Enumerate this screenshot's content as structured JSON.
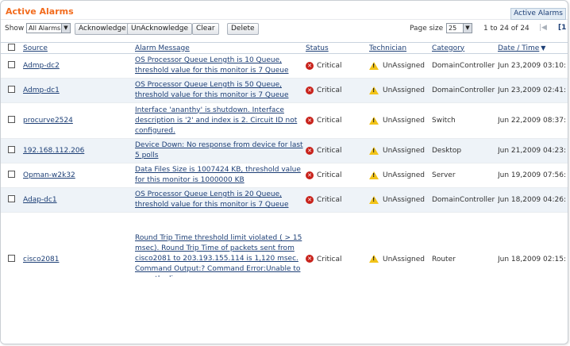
{
  "panel": {
    "title": "Active Alarms",
    "breadcrumb_tab": "Active Alarms"
  },
  "toolbar": {
    "show_label": "Show",
    "filter_select": "All Alarms",
    "acknowledge_label": "Acknowledge",
    "unacknowledge_label": "UnAcknowledge",
    "clear_label": "Clear",
    "delete_label": "Delete",
    "page_size_label": "Page size",
    "page_size_value": "25",
    "range_label": "1 to 24 of 24",
    "page_number_fragment": "[1"
  },
  "table": {
    "columns": {
      "source": "Source",
      "message": "Alarm Message",
      "status": "Status",
      "technician": "Technician",
      "category": "Category",
      "datetime": "Date / Time"
    },
    "rows": [
      {
        "source": "Admp-dc2",
        "message": "OS Processor Queue Length is 10 Queue, threshold value for this monitor is 7 Queue",
        "status": "Critical",
        "technician": "UnAssigned",
        "category": "DomainController",
        "datetime": "Jun 23,2009 03:10:"
      },
      {
        "source": "Admp-dc1",
        "message": "OS Processor Queue Length is 50 Queue, threshold value for this monitor is 7 Queue",
        "status": "Critical",
        "technician": "UnAssigned",
        "category": "DomainController",
        "datetime": "Jun 23,2009 02:41:"
      },
      {
        "source": "procurve2524",
        "message": "Interface 'ananthy' is shutdown. Interface description is '2' and index is 2. Circuit ID not configured.",
        "status": "Critical",
        "technician": "UnAssigned",
        "category": "Switch",
        "datetime": "Jun 22,2009 08:37:"
      },
      {
        "source": "192.168.112.206",
        "message": "Device Down: No response from device for last 5 polls",
        "status": "Critical",
        "technician": "UnAssigned",
        "category": "Desktop",
        "datetime": "Jun 21,2009 04:23:"
      },
      {
        "source": "Opman-w2k32",
        "message": "Data Files Size is 1007424 KB, threshold value for this monitor is 1000000 KB",
        "status": "Critical",
        "technician": "UnAssigned",
        "category": "Server",
        "datetime": "Jun 19,2009 07:56:"
      },
      {
        "source": "Adap-dc1",
        "message": "OS Processor Queue Length is 20 Queue, threshold value for this monitor is 7 Queue",
        "status": "Critical",
        "technician": "UnAssigned",
        "category": "DomainController",
        "datetime": "Jun 18,2009 04:26:"
      },
      {
        "source": "cisco2081",
        "message": "Round Trip Time threshold limit violated ( > 15 msec). Round Trip Time of packets sent from cisco2081 to 203.193.155.114 is 1,120 msec. Command Output:? Command Error:Unable to open the line:",
        "status": "Critical",
        "technician": "UnAssigned",
        "category": "Router",
        "datetime": "Jun 18,2009 02:15:"
      }
    ]
  },
  "colors": {
    "title": "#f26b1d",
    "link": "#1d3f76",
    "critical": "#c8221b",
    "warning": "#f2c318",
    "alt_row": "#eef3f8"
  },
  "icons": {
    "status": "critical-x-icon",
    "technician": "warning-triangle-icon",
    "sort": "sort-descending-icon"
  }
}
